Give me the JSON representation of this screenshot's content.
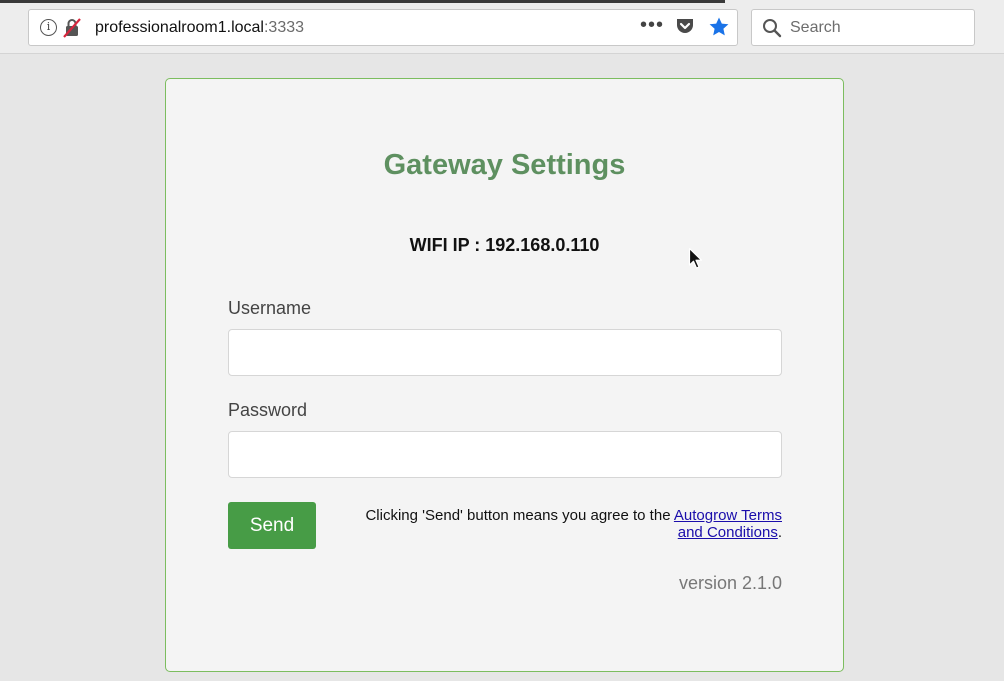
{
  "browser": {
    "url_host": "professionalroom1.local",
    "url_port": ":3333",
    "more_icon": "•••",
    "search_placeholder": "Search",
    "icons": [
      "info-icon",
      "insecure-connection-icon",
      "more-actions-icon",
      "pocket-icon",
      "bookmark-star-icon",
      "search-icon"
    ],
    "accent_color": "#1a73e8"
  },
  "form": {
    "title": "Gateway Settings",
    "wifi_ip": "WIFI IP : 192.168.0.110",
    "username_label": "Username",
    "username_value": "",
    "password_label": "Password",
    "password_value": "",
    "send_label": "Send",
    "terms_prefix": "Clicking 'Send' button means you agree to the ",
    "terms_link": "Autogrow Terms and Conditions",
    "terms_suffix": ".",
    "version": "version 2.1.0",
    "colors": {
      "title": "#5e9060",
      "button": "#479c46",
      "card_border": "#7cbd5f",
      "link": "#1a0dab"
    }
  }
}
